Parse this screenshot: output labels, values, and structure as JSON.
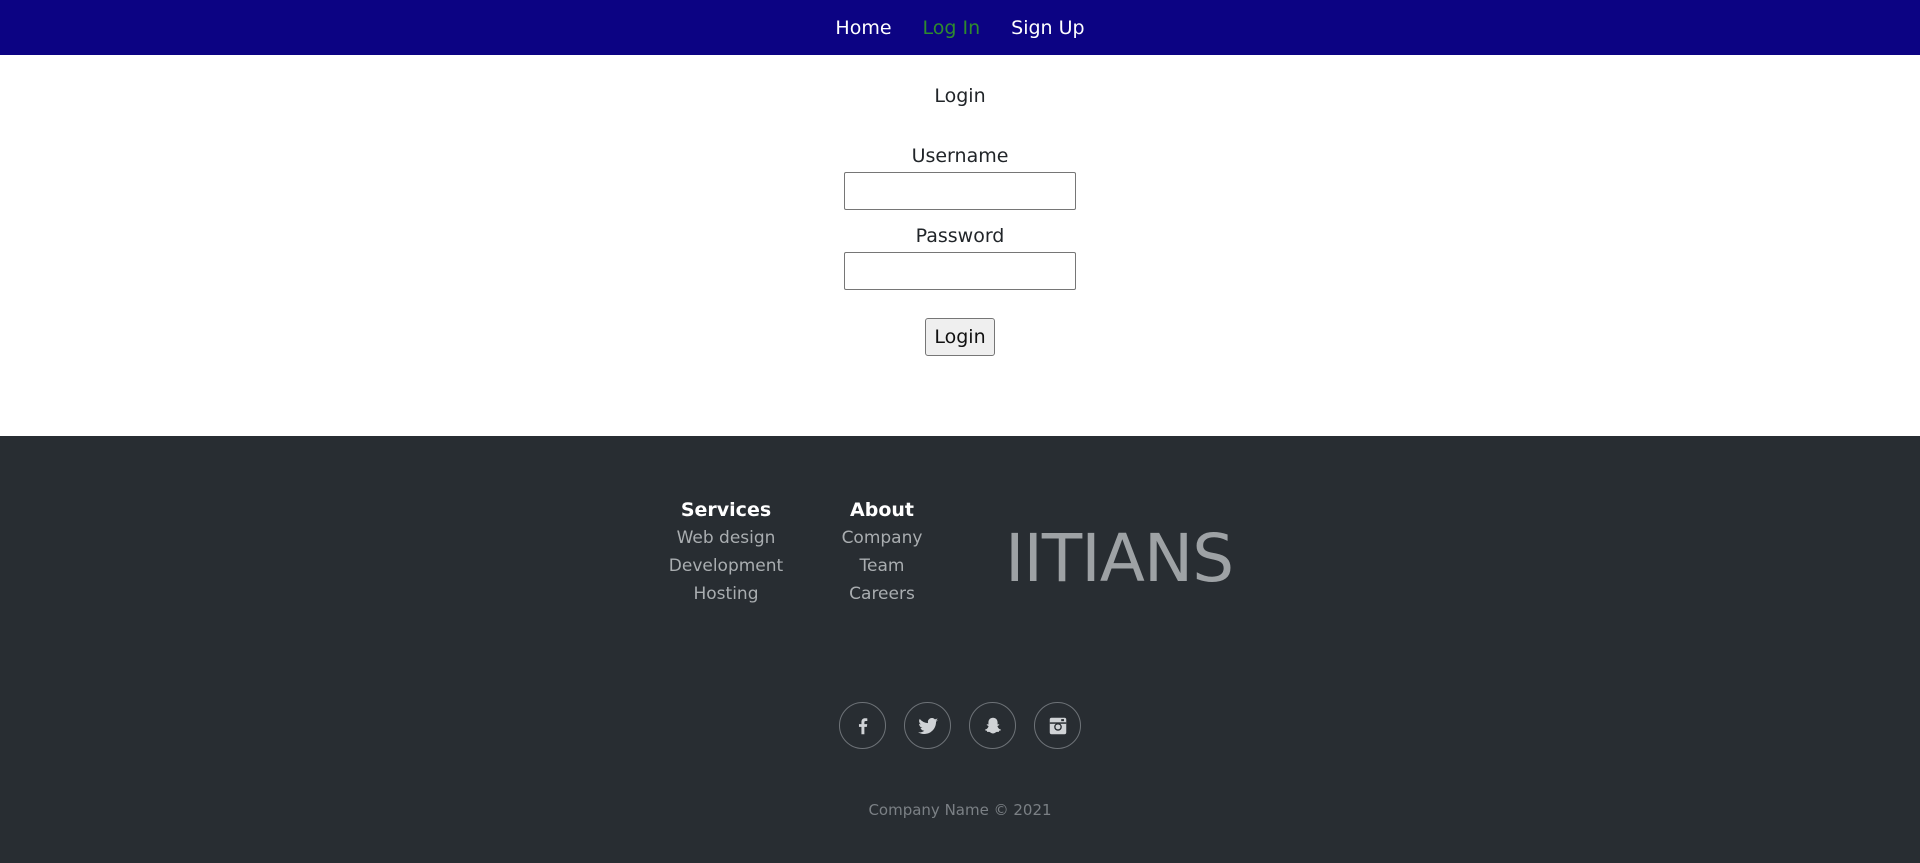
{
  "nav": {
    "home": "Home",
    "login": "Log In",
    "signup": "Sign Up"
  },
  "form": {
    "title": "Login",
    "username_label": "Username",
    "username_value": "",
    "password_label": "Password",
    "password_value": "",
    "submit_label": "Login"
  },
  "footer": {
    "services": {
      "heading": "Services",
      "items": [
        "Web design",
        "Development",
        "Hosting"
      ]
    },
    "about": {
      "heading": "About",
      "items": [
        "Company",
        "Team",
        "Careers"
      ]
    },
    "brand": "IITIANS",
    "social_icons": [
      "facebook-icon",
      "twitter-icon",
      "snapchat-icon",
      "instagram-icon"
    ],
    "copyright": "Company Name © 2021"
  },
  "colors": {
    "nav_bg": "#0c0383",
    "nav_active": "#2e8b2e",
    "footer_bg": "#282d32"
  }
}
